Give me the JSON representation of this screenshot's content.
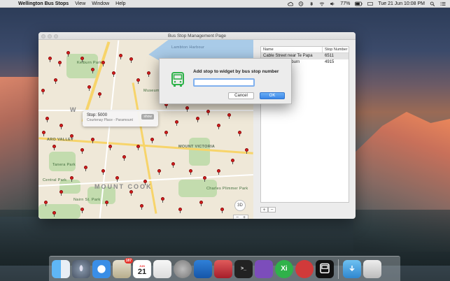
{
  "menubar": {
    "app_name": "Wellington Bus Stops",
    "menus": [
      "View",
      "Window",
      "Help"
    ],
    "battery": "77%",
    "clock": "Tue 21 Jun  10:08 PM"
  },
  "window": {
    "title": "Bus Stop Management Page"
  },
  "map": {
    "callout_stop": "Stop: 5000",
    "callout_address": "Courtenay Place - Paramount",
    "callout_button": "show",
    "labels": {
      "kelburn": "Kelburn Park",
      "w_big": "W",
      "mt_vic": "MOUNT VICTORIA",
      "mountcook": "MOUNT COOK",
      "aro": "ARO VALLEY",
      "central": "Central Park",
      "tanera": "Tanera Park",
      "nairn": "Nairn St. Park",
      "te_papa": "Museum of New Zealand",
      "charles": "Charles Plimmer Park",
      "lambton": "Lambton Harbour"
    },
    "compass": "3D",
    "zoom_out": "−",
    "zoom_in": "+"
  },
  "table": {
    "headers": [
      "Name",
      "Stop Number"
    ],
    "rows": [
      {
        "name": "Cable Street near Te Papa",
        "number": "6511"
      },
      {
        "name": "University - Kelburn",
        "number": "4915"
      }
    ],
    "add": "+",
    "remove": "−"
  },
  "dialog": {
    "title": "Add stop to widget by bus stop number",
    "input_value": "",
    "cancel": "Cancel",
    "ok": "OK",
    "icon": "bus-icon",
    "accent": "#2fb24a"
  },
  "dock": {
    "calendar_month": "JUN",
    "calendar_day": "21",
    "mail_badge": "187",
    "xi": "Xi"
  }
}
